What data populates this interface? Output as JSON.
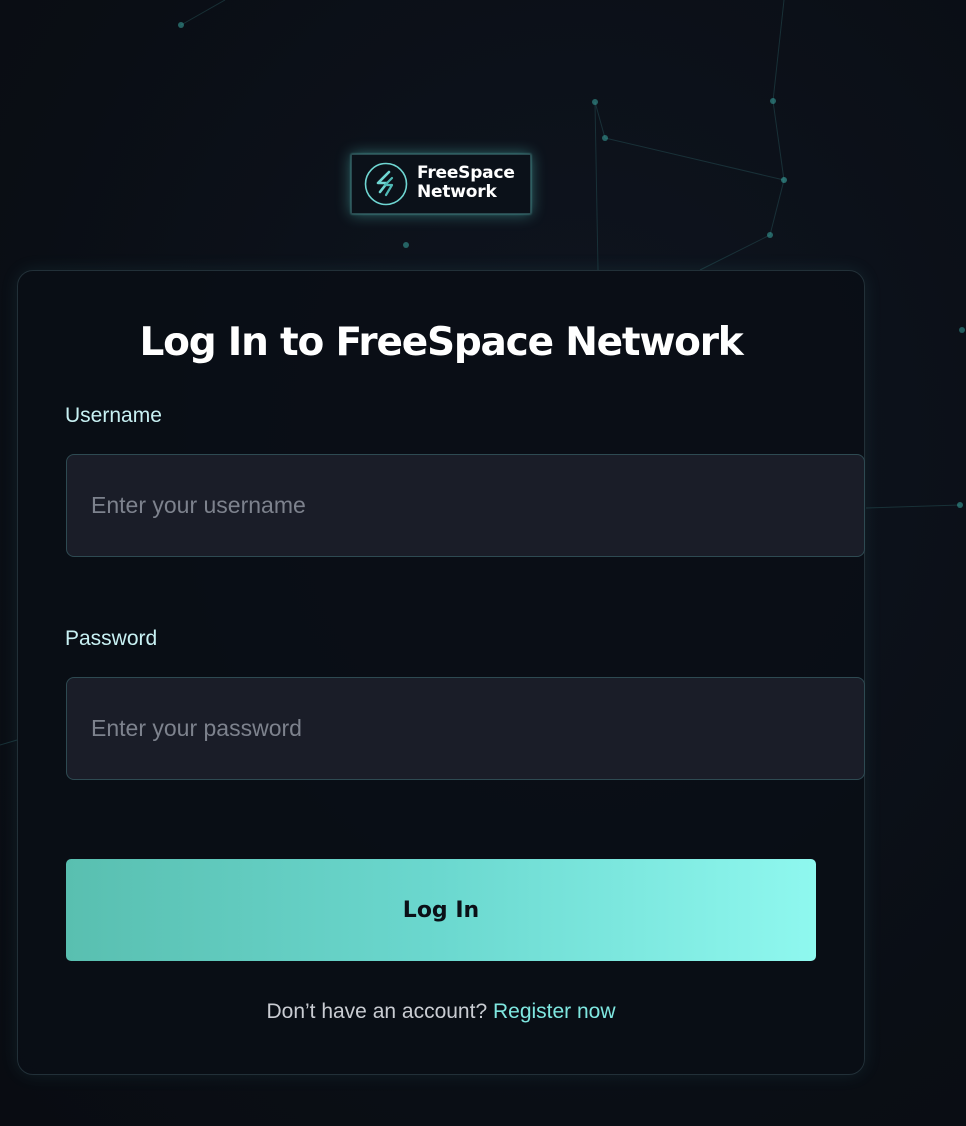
{
  "brand": {
    "name_line1": "FreeSpace",
    "name_line2": "Network",
    "icon": "freespace-logo-icon"
  },
  "form": {
    "title": "Log In to FreeSpace Network",
    "username": {
      "label": "Username",
      "placeholder": "Enter your username",
      "value": ""
    },
    "password": {
      "label": "Password",
      "placeholder": "Enter your password",
      "value": ""
    },
    "submit_label": "Log In",
    "register_prompt": "Don’t have an account?",
    "register_link": "Register now"
  },
  "colors": {
    "background": "#0b0f17",
    "accent": "#7fe7e0",
    "button_gradient_start": "#59bfb0",
    "button_gradient_end": "#8ff8ef",
    "input_background": "#1a1d28"
  }
}
